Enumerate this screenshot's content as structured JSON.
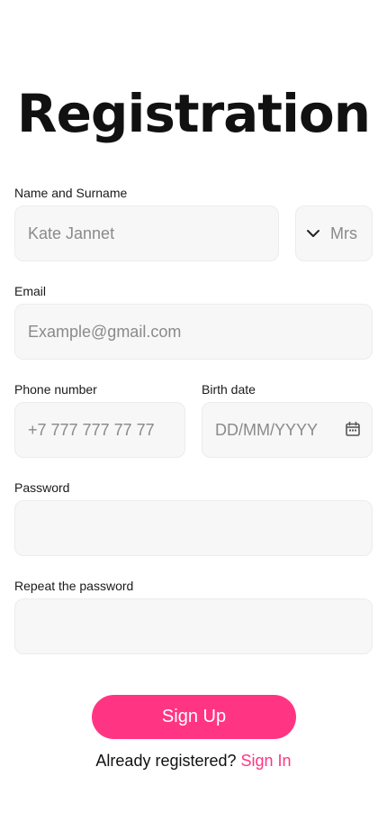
{
  "page_title": "Registration",
  "fields": {
    "name": {
      "label": "Name and Surname",
      "placeholder": "Kate Jannet",
      "value": ""
    },
    "title_select": {
      "value": "Mrs",
      "icon": "chevron-down-icon"
    },
    "email": {
      "label": "Email",
      "placeholder": "Example@gmail.com",
      "value": ""
    },
    "phone": {
      "label": "Phone number",
      "placeholder": "+7 777 777 77 77",
      "value": ""
    },
    "birth_date": {
      "label": "Birth date",
      "placeholder": "DD/MM/YYYY",
      "value": "",
      "icon": "calendar-icon"
    },
    "password": {
      "label": "Password",
      "placeholder": "",
      "value": ""
    },
    "repeat_password": {
      "label": "Repeat the password",
      "placeholder": "",
      "value": ""
    }
  },
  "actions": {
    "sign_up_label": "Sign Up",
    "already_registered_text": "Already registered?",
    "sign_in_label": "Sign In"
  },
  "colors": {
    "accent": "#ff3583",
    "field_background": "#f7f7f7",
    "field_border": "#ececec",
    "placeholder_text": "#8a8a8a",
    "title_text": "#111111"
  }
}
